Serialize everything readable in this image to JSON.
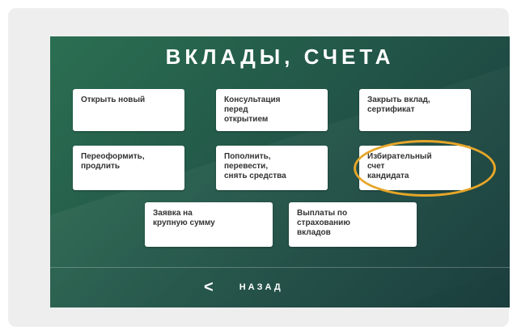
{
  "screen": {
    "title": "ВКЛАДЫ, СЧЕТА"
  },
  "tiles": [
    {
      "label": "Открыть новый"
    },
    {
      "label": "Консультация\nперед\nоткрытием"
    },
    {
      "label": "Закрыть вклад,\nсертификат"
    },
    {
      "label": "Переоформить,\nпродлить"
    },
    {
      "label": "Пополнить,\nперевести,\nснять средства"
    },
    {
      "label": "Избирательный\nсчет\nкандидата"
    },
    {
      "label": "Заявка на\nкрупную сумму"
    },
    {
      "label": "Выплаты по\nстрахованию\nвкладов"
    }
  ],
  "navigation": {
    "back_icon": "chevron-left-icon",
    "back_glyph": "<",
    "back_label": "НАЗАД"
  },
  "colors": {
    "highlight": "#e6a628",
    "screen_green": "#245c4a"
  }
}
